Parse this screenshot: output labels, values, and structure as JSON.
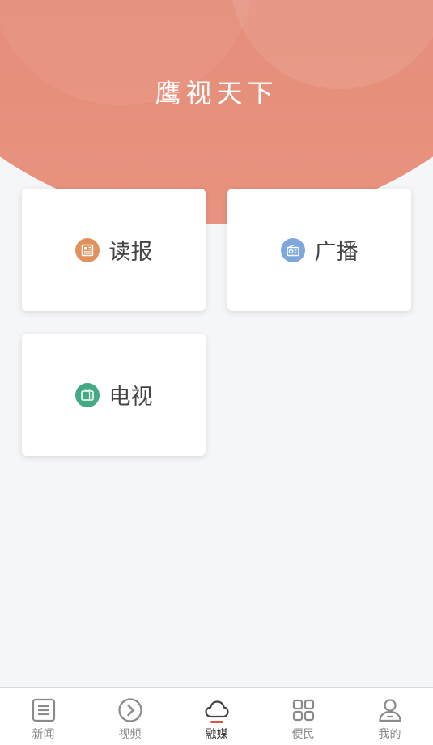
{
  "header": {
    "title": "鹰视天下"
  },
  "cards": {
    "paper": {
      "label": "读报",
      "icon": "newspaper-icon",
      "color": "#e0925c"
    },
    "radio": {
      "label": "广播",
      "icon": "radio-icon",
      "color": "#7ea7dc"
    },
    "tv": {
      "label": "电视",
      "icon": "tv-icon",
      "color": "#43aa85"
    }
  },
  "tabbar": {
    "items": [
      {
        "label": "新闻",
        "icon": "news-list-icon",
        "active": false
      },
      {
        "label": "视频",
        "icon": "play-circle-icon",
        "active": false
      },
      {
        "label": "融媒",
        "icon": "cloud-icon",
        "active": true
      },
      {
        "label": "便民",
        "icon": "grid-icon",
        "active": false
      },
      {
        "label": "我的",
        "icon": "user-icon",
        "active": false
      }
    ],
    "active_color": "#e2513f"
  }
}
